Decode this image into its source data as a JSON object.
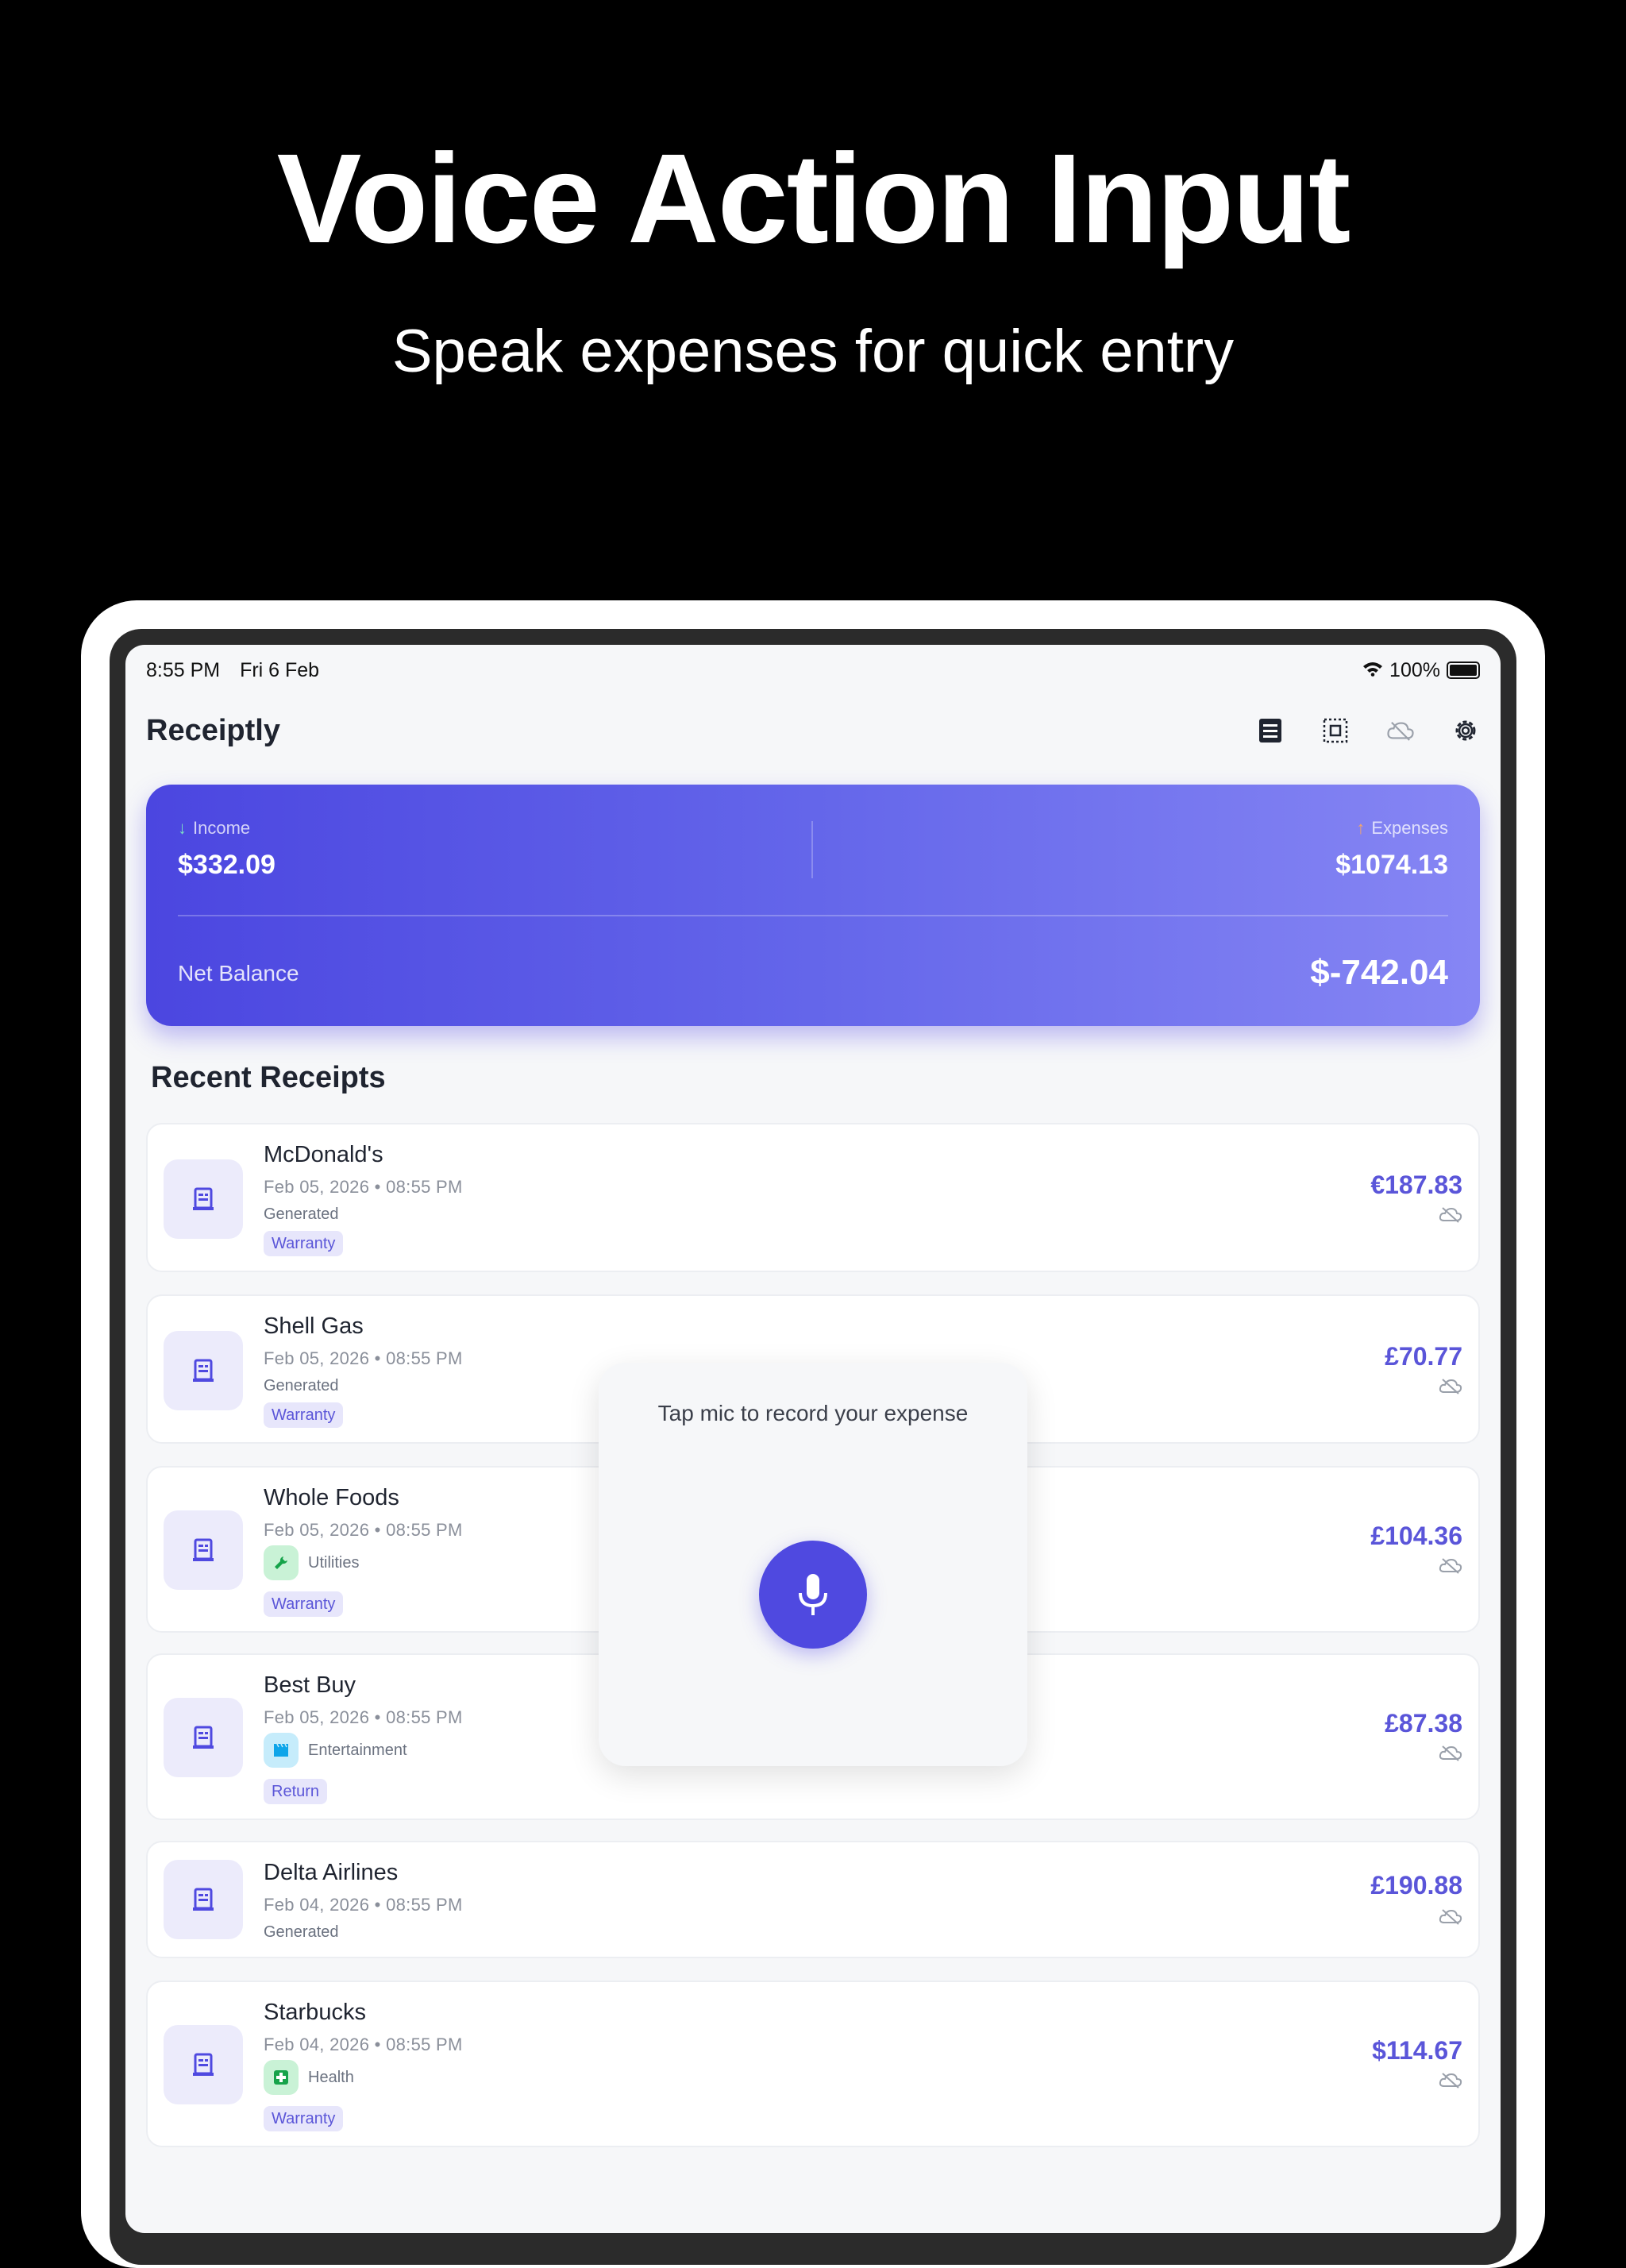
{
  "hero": {
    "title": "Voice Action Input",
    "subtitle": "Speak expenses for quick entry"
  },
  "status_bar": {
    "time": "8:55 PM",
    "date": "Fri 6 Feb",
    "battery": "100%"
  },
  "app": {
    "title": "Receiptly",
    "toolbar_icons": [
      "receipt-list-icon",
      "scan-icon",
      "cloud-off-icon",
      "gear-icon"
    ]
  },
  "summary": {
    "income_label": "Income",
    "income_value": "$332.09",
    "expenses_label": "Expenses",
    "expenses_value": "$1074.13",
    "net_label": "Net Balance",
    "net_value": "$-742.04"
  },
  "section_title": "Recent Receipts",
  "receipts": [
    {
      "merchant": "McDonald's",
      "date": "Feb 05, 2026 • 08:55 PM",
      "status": "Generated",
      "tag": "Warranty",
      "amount": "€187.83"
    },
    {
      "merchant": "Shell Gas",
      "date": "Feb 05, 2026 • 08:55 PM",
      "status": "Generated",
      "tag": "Warranty",
      "amount": "£70.77"
    },
    {
      "merchant": "Whole Foods",
      "date": "Feb 05, 2026 • 08:55 PM",
      "category": "Utilities",
      "tag": "Warranty",
      "amount": "£104.36"
    },
    {
      "merchant": "Best Buy",
      "date": "Feb 05, 2026 • 08:55 PM",
      "category": "Entertainment",
      "tag": "Return",
      "amount": "£87.38"
    },
    {
      "merchant": "Delta Airlines",
      "date": "Feb 04, 2026 • 08:55 PM",
      "status": "Generated",
      "amount": "£190.88"
    },
    {
      "merchant": "Starbucks",
      "date": "Feb 04, 2026 • 08:55 PM",
      "category": "Health",
      "tag": "Warranty",
      "amount": "$114.67"
    }
  ],
  "voice_popup": {
    "prompt": "Tap mic to record your expense"
  },
  "colors": {
    "accent": "#4f49e0",
    "income_arrow": "#7ee0c4",
    "expense_arrow": "#f4a56b",
    "utilities": "#22c55e",
    "entertainment": "#0ea5e9",
    "health": "#16a34a"
  }
}
